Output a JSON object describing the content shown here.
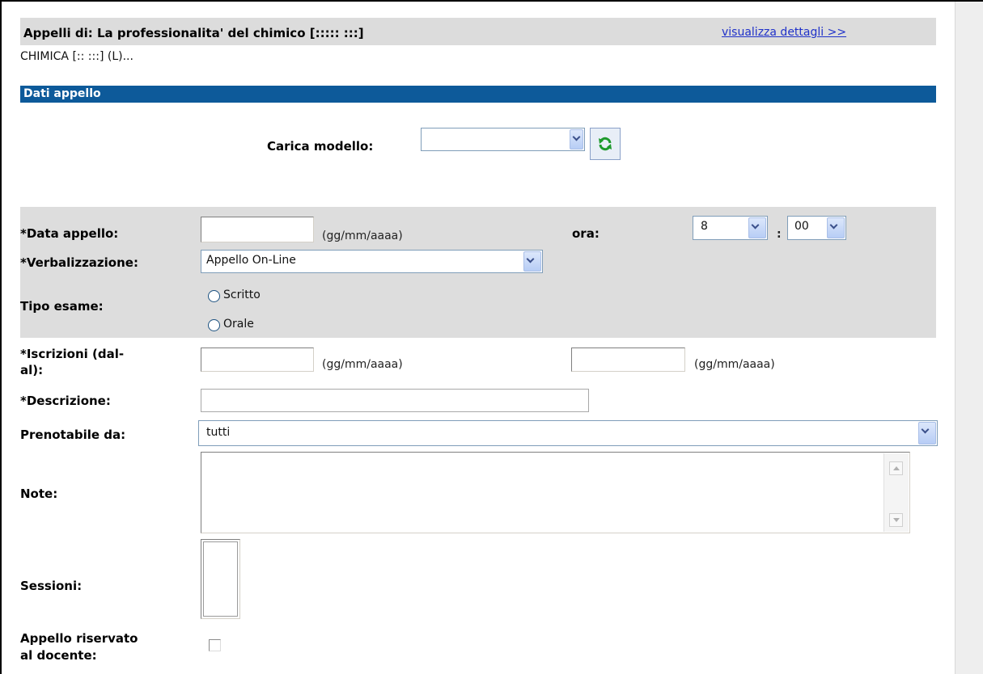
{
  "header": {
    "course_title": "Appelli di: La professionalita' del chimico [::::: :::]",
    "details_link": "visualizza dettagli >>",
    "course_subtitle": "CHIMICA [:: :::] (L)..."
  },
  "section": {
    "title": "Dati appello"
  },
  "form": {
    "template_label": "Carica modello:",
    "template_value": "",
    "date_label": "*Data appello:",
    "date_value": "",
    "date_hint": "(gg/mm/aaaa)",
    "time_label": "ora:",
    "hour_value": "8",
    "time_separator": ":",
    "minute_value": "00",
    "verbalization_label": "*Verbalizzazione:",
    "verbalization_value": "Appello On-Line",
    "exam_type_label": "Tipo esame:",
    "exam_type_options": [
      "Scritto",
      "Orale"
    ],
    "registration_label": "*Iscrizioni (dal-\nal):",
    "registration_from": "",
    "registration_to": "",
    "registration_hint_from": "(gg/mm/aaaa)",
    "registration_hint_to": "(gg/mm/aaaa)",
    "description_label": "*Descrizione:",
    "description_value": "",
    "bookable_label": "Prenotabile da:",
    "bookable_value": "tutti",
    "notes_label": "Note:",
    "notes_value": "",
    "sessions_label": "Sessioni:",
    "reserved_label": "Appello riservato\nal docente:",
    "reserved_checked": false
  },
  "icons": {
    "refresh": "refresh-icon",
    "dropdown": "chevron-down-icon"
  },
  "colors": {
    "section_bar": "#0d5a9a",
    "link": "#1f31c9",
    "header_bg": "#dcdcdc",
    "form_block_bg": "#dddddd"
  }
}
